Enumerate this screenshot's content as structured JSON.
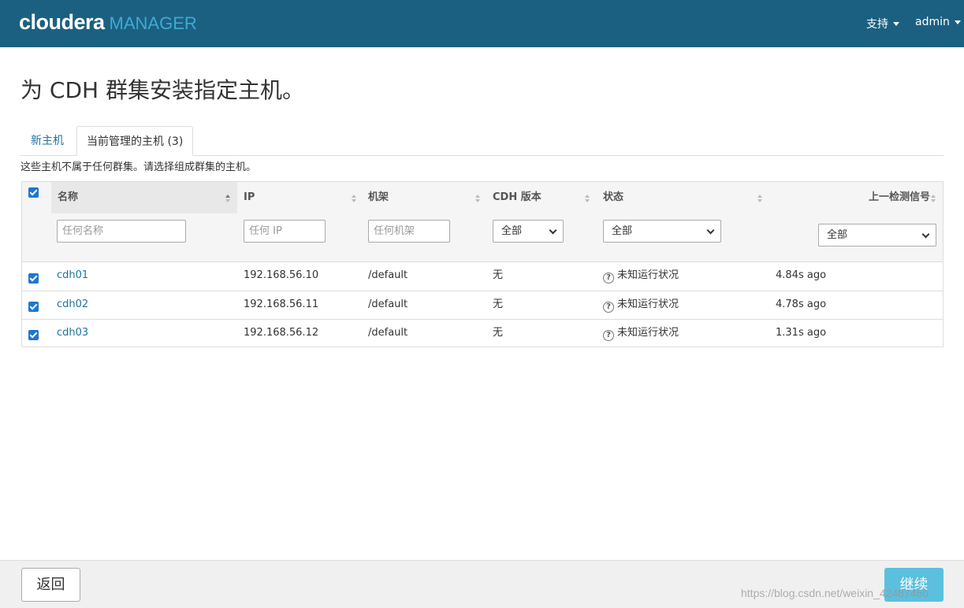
{
  "header": {
    "logo_main": "cloudera",
    "logo_sub": "MANAGER",
    "menu_support": "支持",
    "menu_user": "admin"
  },
  "page": {
    "title": "为 CDH 群集安装指定主机。",
    "help_text": "这些主机不属于任何群集。请选择组成群集的主机。"
  },
  "tabs": [
    {
      "label": "新主机",
      "active": false
    },
    {
      "label": "当前管理的主机 (3)",
      "active": true
    }
  ],
  "table": {
    "columns": {
      "name": "名称",
      "ip": "IP",
      "rack": "机架",
      "cdh_version": "CDH 版本",
      "status": "状态",
      "last_heartbeat": "上一检测信号"
    },
    "filters": {
      "name_placeholder": "任何名称",
      "ip_placeholder": "任何 IP",
      "rack_placeholder": "任何机架",
      "cdh_version_selected": "全部",
      "status_selected": "全部",
      "heartbeat_selected": "全部"
    },
    "rows": [
      {
        "checked": true,
        "name": "cdh01",
        "ip": "192.168.56.10",
        "rack": "/default",
        "cdh_version": "无",
        "status": "未知运行状况",
        "heartbeat": "4.84s ago"
      },
      {
        "checked": true,
        "name": "cdh02",
        "ip": "192.168.56.11",
        "rack": "/default",
        "cdh_version": "无",
        "status": "未知运行状况",
        "heartbeat": "4.78s ago"
      },
      {
        "checked": true,
        "name": "cdh03",
        "ip": "192.168.56.12",
        "rack": "/default",
        "cdh_version": "无",
        "status": "未知运行状况",
        "heartbeat": "1.31s ago"
      }
    ]
  },
  "footer": {
    "back_label": "返回",
    "continue_label": "继续",
    "watermark": "https://blog.csdn.net/weixin_42487460"
  },
  "colors": {
    "header_bg": "#1b6080",
    "link": "#1f72a1",
    "checkbox": "#1e76d2",
    "continue_button": "#5bc0de"
  }
}
